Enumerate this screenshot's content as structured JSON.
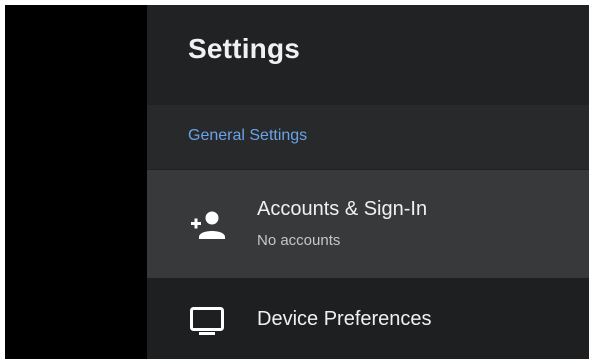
{
  "header": {
    "title": "Settings"
  },
  "section": {
    "title": "General Settings"
  },
  "items": [
    {
      "title": "Accounts & Sign-In",
      "subtitle": "No accounts",
      "icon": "add-person-icon"
    },
    {
      "title": "Device Preferences",
      "icon": "tv-monitor-icon"
    }
  ],
  "colors": {
    "panel_background": "#1f2021",
    "selected_item_background": "#37393a",
    "section_title": "#6aa3e8",
    "text_primary": "#f0f0f0",
    "text_secondary": "#c4c6c8"
  }
}
